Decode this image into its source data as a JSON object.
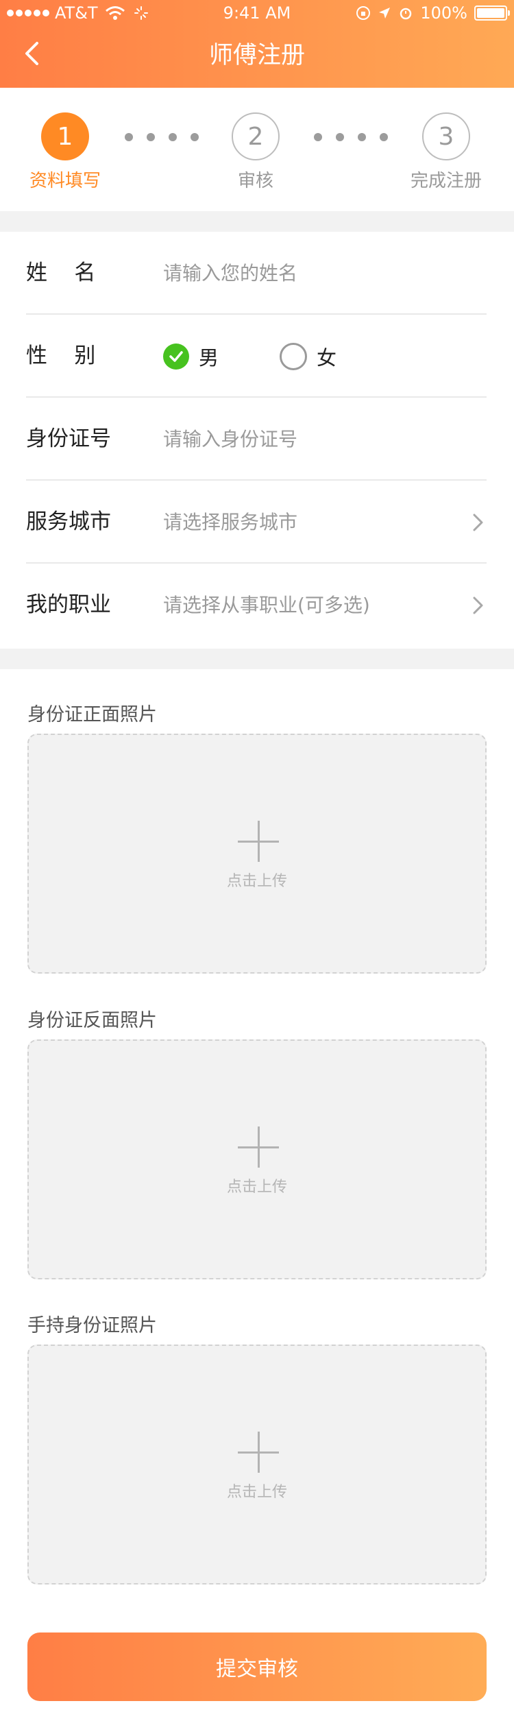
{
  "status_bar": {
    "carrier": "AT&T",
    "time": "9:41 AM",
    "battery": "100%"
  },
  "header": {
    "title": "师傅注册"
  },
  "steps": [
    {
      "number": "1",
      "label": "资料填写",
      "active": true
    },
    {
      "number": "2",
      "label": "审核",
      "active": false
    },
    {
      "number": "3",
      "label": "完成注册",
      "active": false
    }
  ],
  "form": {
    "name": {
      "label": "姓    名",
      "placeholder": "请输入您的姓名"
    },
    "gender": {
      "label": "性    别",
      "options": [
        "男",
        "女"
      ],
      "selected": "男"
    },
    "id_number": {
      "label": "身份证号",
      "placeholder": "请输入身份证号"
    },
    "city": {
      "label": "服务城市",
      "placeholder": "请选择服务城市"
    },
    "job": {
      "label": "我的职业",
      "placeholder": "请选择从事职业(可多选)"
    }
  },
  "uploads": [
    {
      "title": "身份证正面照片",
      "hint": "点击上传"
    },
    {
      "title": "身份证反面照片",
      "hint": "点击上传"
    },
    {
      "title": "手持身份证照片",
      "hint": "点击上传"
    }
  ],
  "submit_label": "提交审核",
  "colors": {
    "accent": "#ff8a24",
    "radio_on": "#47c21f",
    "gradient_start": "#ff7e45",
    "gradient_end": "#ffa955"
  }
}
